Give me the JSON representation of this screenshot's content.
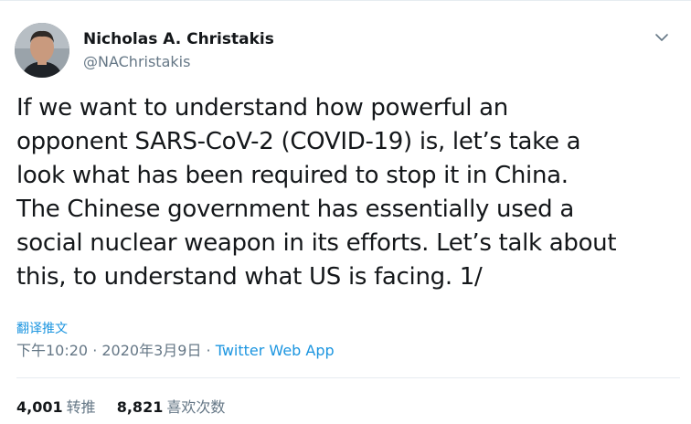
{
  "author": {
    "name": "Nicholas A. Christakis",
    "handle": "@NAChristakis"
  },
  "tweet": {
    "lines": [
      "If we want to understand how powerful an",
      "opponent SARS-CoV-2 (COVID-19) is, let’s take a",
      "look what has been required to stop it in China.",
      "The Chinese government has essentially used a",
      "social nuclear weapon in its efforts. Let’s talk about",
      "this, to understand what US is facing. 1/"
    ],
    "translate_label": "翻译推文",
    "timestamp": "下午10:20 · 2020年3月9日",
    "separator": " · ",
    "source": "Twitter Web App"
  },
  "stats": {
    "retweets_count": "4,001",
    "retweets_label": "转推",
    "likes_count": "8,821",
    "likes_label": "喜欢次数"
  },
  "icons": {
    "menu": "chevron-down-icon"
  },
  "colors": {
    "link": "#1b95e0",
    "secondary_text": "#657786",
    "primary_text": "#14171a"
  }
}
